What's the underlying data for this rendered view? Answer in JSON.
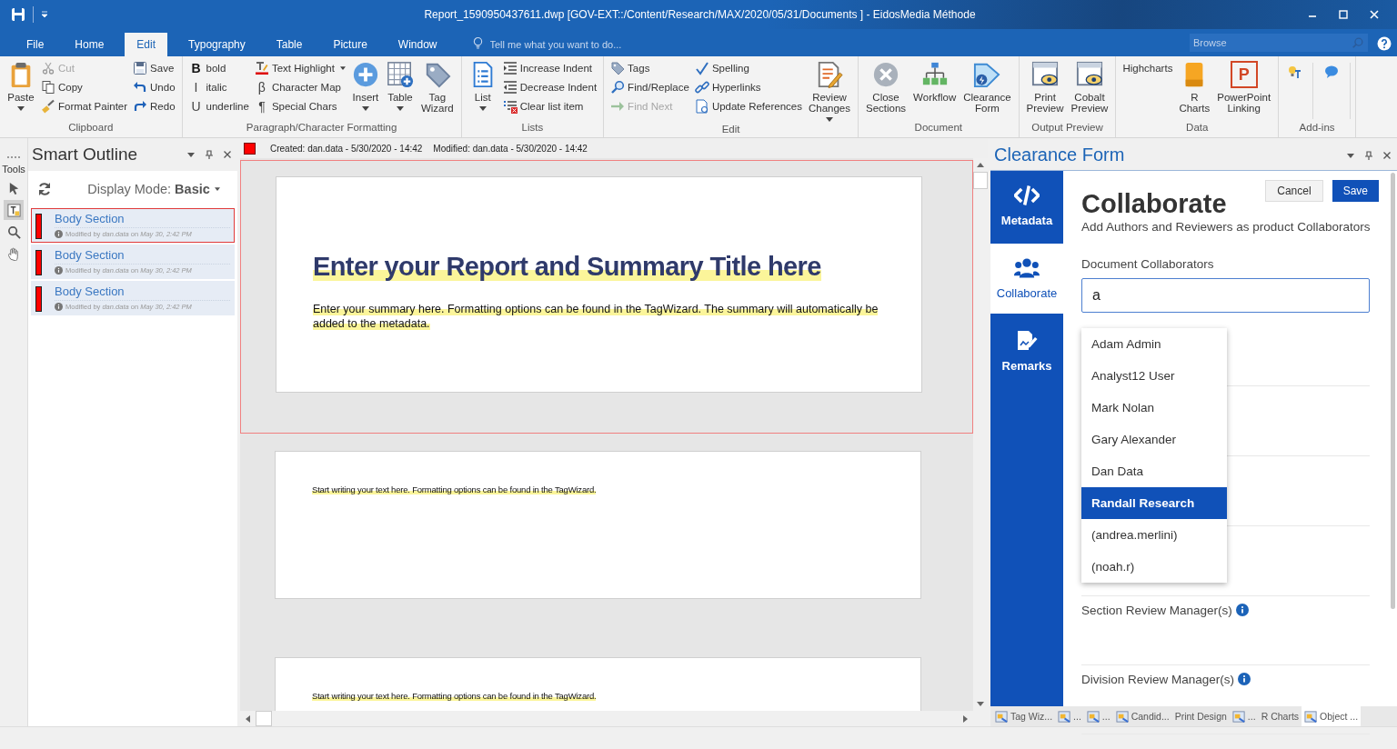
{
  "window": {
    "title": "Report_1590950437611.dwp  [GOV-EXT::/Content/Research/MAX/2020/05/31/Documents ] - EidosMedia Méthode"
  },
  "menu_tabs": [
    {
      "label": "File",
      "selected": false
    },
    {
      "label": "Home",
      "selected": false
    },
    {
      "label": "Edit",
      "selected": true
    },
    {
      "label": "Typography",
      "selected": false
    },
    {
      "label": "Table",
      "selected": false
    },
    {
      "label": "Picture",
      "selected": false
    },
    {
      "label": "Window",
      "selected": false
    }
  ],
  "tell_me": {
    "placeholder": "Tell me what you want to do..."
  },
  "browse": {
    "placeholder": "Browse"
  },
  "ribbon": [
    {
      "label": "Clipboard",
      "columns": [
        {
          "kind": "large",
          "items": [
            {
              "label": "Paste",
              "disabled": false,
              "dropdown": true
            }
          ]
        },
        {
          "kind": "stack",
          "items": [
            {
              "label": "Cut",
              "disabled": true,
              "dropdown": false
            },
            {
              "label": "Copy",
              "disabled": false,
              "dropdown": false
            },
            {
              "label": "Format Painter",
              "disabled": false,
              "dropdown": false
            }
          ]
        },
        {
          "kind": "stack",
          "items": [
            {
              "label": "Save",
              "disabled": false,
              "dropdown": false
            },
            {
              "label": "Undo",
              "disabled": false,
              "dropdown": false
            },
            {
              "label": "Redo",
              "disabled": false,
              "dropdown": false
            }
          ]
        }
      ]
    },
    {
      "label": "Paragraph/Character Formatting",
      "columns": [
        {
          "kind": "stack",
          "items": [
            {
              "label": "bold",
              "glyph": "B",
              "disabled": false,
              "dropdown": false
            },
            {
              "label": "italic",
              "glyph": "I",
              "disabled": false,
              "dropdown": false
            },
            {
              "label": "underline",
              "glyph": "U",
              "disabled": false,
              "dropdown": false
            }
          ]
        },
        {
          "kind": "stack",
          "items": [
            {
              "label": "Text Highlight",
              "disabled": false,
              "dropdown": true
            },
            {
              "label": "Character Map",
              "glyph": "β",
              "disabled": false,
              "dropdown": false
            },
            {
              "label": "Special Chars",
              "glyph": "¶",
              "disabled": false,
              "dropdown": false
            }
          ]
        },
        {
          "kind": "large",
          "items": [
            {
              "label": "Insert",
              "disabled": false,
              "dropdown": true
            },
            {
              "label": "Table",
              "disabled": false,
              "dropdown": true
            },
            {
              "label": "Tag Wizard",
              "disabled": false,
              "dropdown": false
            }
          ]
        }
      ]
    },
    {
      "label": "Lists",
      "columns": [
        {
          "kind": "large",
          "items": [
            {
              "label": "List",
              "disabled": false,
              "dropdown": true
            }
          ]
        },
        {
          "kind": "stack",
          "items": [
            {
              "label": "Increase Indent",
              "disabled": false,
              "dropdown": false
            },
            {
              "label": "Decrease Indent",
              "disabled": false,
              "dropdown": false
            },
            {
              "label": "Clear list item",
              "disabled": false,
              "dropdown": false
            }
          ]
        }
      ]
    },
    {
      "label": "Edit",
      "columns": [
        {
          "kind": "stack",
          "items": [
            {
              "label": "Tags",
              "disabled": false,
              "dropdown": false
            },
            {
              "label": "Find/Replace",
              "disabled": false,
              "dropdown": false
            },
            {
              "label": "Find Next",
              "disabled": true,
              "dropdown": false
            }
          ]
        },
        {
          "kind": "stack",
          "items": [
            {
              "label": "Spelling",
              "disabled": false,
              "dropdown": false
            },
            {
              "label": "Hyperlinks",
              "disabled": false,
              "dropdown": false
            },
            {
              "label": "Update References",
              "disabled": false,
              "dropdown": false
            }
          ]
        },
        {
          "kind": "large",
          "items": [
            {
              "label": "Review Changes",
              "disabled": false,
              "dropdown": true
            }
          ]
        }
      ]
    },
    {
      "label": "Document",
      "columns": [
        {
          "kind": "large",
          "items": [
            {
              "label": "Close Sections",
              "disabled": false,
              "dropdown": false
            },
            {
              "label": "Workflow",
              "disabled": false,
              "dropdown": false
            },
            {
              "label": "Clearance Form",
              "disabled": false,
              "dropdown": false
            }
          ]
        }
      ]
    },
    {
      "label": "Output Preview",
      "columns": [
        {
          "kind": "large",
          "items": [
            {
              "label": "Print Preview",
              "disabled": false,
              "dropdown": false
            },
            {
              "label": "Cobalt Preview",
              "disabled": false,
              "dropdown": false
            }
          ]
        }
      ]
    },
    {
      "label": "Data",
      "columns": [
        {
          "kind": "text",
          "items": [
            {
              "label": "Highcharts",
              "disabled": false,
              "dropdown": false
            }
          ]
        },
        {
          "kind": "large",
          "items": [
            {
              "label": "R Charts",
              "disabled": false,
              "dropdown": false
            },
            {
              "label": "PowerPoint Linking",
              "glyph": "P",
              "disabled": false,
              "dropdown": false
            }
          ]
        }
      ]
    },
    {
      "label": "Add-ins",
      "columns": [
        {
          "kind": "addins"
        }
      ]
    }
  ],
  "tools": {
    "title": "Tools",
    "items": [
      {
        "selected": false
      },
      {
        "selected": true
      },
      {
        "selected": false
      },
      {
        "selected": false
      }
    ]
  },
  "outline": {
    "title": "Smart Outline",
    "display_label": "Display Mode:",
    "display_value": "Basic",
    "items": [
      {
        "title": "Body Section",
        "meta": "Modified by *dan.data* on *May 30, 2:42 PM*",
        "color": "#ff0000",
        "selected": true
      },
      {
        "title": "Body Section",
        "meta": "Modified by *dan.data* on *May 30, 2:42 PM*",
        "color": "#ff0000",
        "selected": false
      },
      {
        "title": "Body Section",
        "meta": "Modified by *dan.data* on *May 30, 2:42 PM*",
        "color": "#ff0000",
        "selected": false
      }
    ]
  },
  "document": {
    "created": "Created: dan.data - 5/30/2020 - 14:42",
    "modified": "Modified: dan.data - 5/30/2020 - 14:42",
    "pages": [
      {
        "kind": "title",
        "selected": true,
        "title": "Enter your Report and Summary Title here",
        "text": "Enter your summary here. Formatting options can be found in the TagWizard. The summary will automatically be added to the metadata."
      },
      {
        "kind": "body",
        "selected": false,
        "text": "Start writing your text here. Formatting options can be found in the TagWizard."
      },
      {
        "kind": "body",
        "selected": false,
        "text": "Start writing your text here. Formatting options can be found in the TagWizard."
      }
    ]
  },
  "clearance": {
    "title": "Clearance Form",
    "nav": [
      {
        "label": "Metadata",
        "selected": false
      },
      {
        "label": "Collaborate",
        "selected": true
      },
      {
        "label": "Remarks",
        "selected": false
      }
    ],
    "cancel": "Cancel",
    "save": "Save",
    "heading": "Collaborate",
    "subtitle": "Add Authors and Reviewers as product Collaborators",
    "field_label": "Document Collaborators",
    "field_value": "a",
    "suggestions": [
      {
        "label": "Adam Admin",
        "selected": false
      },
      {
        "label": "Analyst12 User",
        "selected": false
      },
      {
        "label": "Mark Nolan",
        "selected": false
      },
      {
        "label": "Gary Alexander",
        "selected": false
      },
      {
        "label": "Dan Data",
        "selected": false
      },
      {
        "label": "Randall Research",
        "selected": true
      },
      {
        "label": "(andrea.merlini)",
        "selected": false
      },
      {
        "label": "(noah.r)",
        "selected": false
      }
    ],
    "sections": [
      "Section Review Manager(s)",
      "Division Review Manager(s)"
    ]
  },
  "bottom_tabs": [
    {
      "label": "Tag Wiz...",
      "kind": "icon",
      "selected": false
    },
    {
      "label": "...",
      "kind": "icon",
      "selected": false
    },
    {
      "label": "...",
      "kind": "icon",
      "selected": false
    },
    {
      "label": "Candid...",
      "kind": "icon",
      "selected": false
    },
    {
      "label": "Print Design",
      "kind": "plain",
      "selected": false
    },
    {
      "label": "...",
      "kind": "icon",
      "selected": false
    },
    {
      "label": "R Charts",
      "kind": "plain",
      "selected": false
    },
    {
      "label": "Object ...",
      "kind": "icon",
      "selected": true
    }
  ]
}
